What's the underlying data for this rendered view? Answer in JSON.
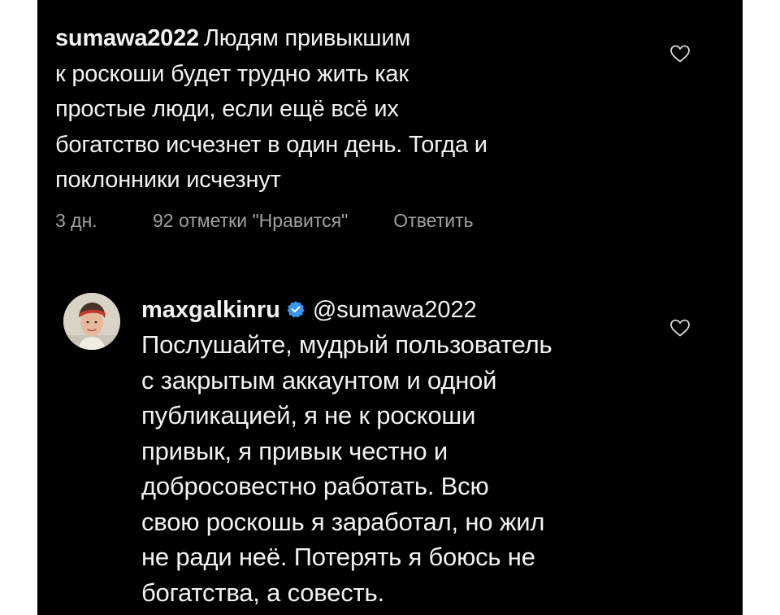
{
  "comment_1": {
    "username": "sumawa2022",
    "lines": [
      "Людям привыкшим",
      "к роскоши будет трудно жить как",
      "простые люди, если ещё всё их",
      "богатство исчезнет в один день. Тогда и",
      "поклонники исчезнут"
    ],
    "time": "3 дн.",
    "likes": "92 отметки \"Нравится\"",
    "reply_label": "Ответить"
  },
  "comment_2": {
    "username": "maxgalkinru",
    "mention": "@sumawa2022",
    "lines": [
      "Послушайте, мудрый пользователь",
      "с закрытым аккаунтом и одной",
      "публикацией, я не к роскоши",
      "привык, я привык честно и",
      "добросовестно работать. Всю",
      "свою роскошь я заработал, но жил",
      "не ради неё. Потерять я боюсь не",
      "богатства, а совесть."
    ]
  },
  "icons": {
    "like": "heart-outline-icon",
    "verified": "verified-badge-icon"
  },
  "colors": {
    "background": "#000000",
    "text": "#f2f2f2",
    "meta": "#a0a0a0",
    "verified": "#3897f0"
  }
}
